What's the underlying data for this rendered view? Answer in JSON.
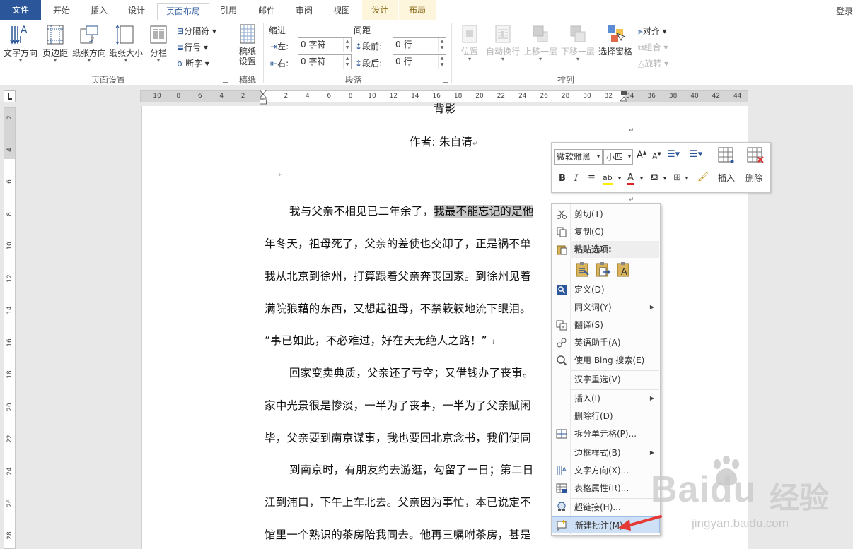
{
  "tabs": [
    "文件",
    "开始",
    "插入",
    "设计",
    "页面布局",
    "引用",
    "邮件",
    "审阅",
    "视图",
    "设计",
    "布局"
  ],
  "login": "登录",
  "ribbon": {
    "page_setup": {
      "text_direction": "文字方向",
      "margins": "页边距",
      "orientation": "纸张方向",
      "size": "纸张大小",
      "columns": "分栏",
      "breaks": "分隔符",
      "line_numbers": "行号",
      "hyphenation": "断字",
      "label": "页面设置"
    },
    "manuscript": {
      "button": "稿纸\n设置",
      "label": "稿纸"
    },
    "paragraph": {
      "indent": "缩进",
      "spacing": "间距",
      "left": "左:",
      "right": "右:",
      "before": "段前:",
      "after": "段后:",
      "left_val": "0 字符",
      "right_val": "0 字符",
      "before_val": "0 行",
      "after_val": "0 行",
      "label": "段落"
    },
    "arrange": {
      "position": "位置",
      "wrap": "自动换行",
      "forward": "上移一层",
      "backward": "下移一层",
      "pane": "选择窗格",
      "align": "对齐",
      "group": "组合",
      "rotate": "旋转",
      "label": "排列"
    }
  },
  "ruler": {
    "h_ticks": [
      "10",
      "8",
      "6",
      "4",
      "2",
      "",
      "2",
      "4",
      "6",
      "8",
      "10",
      "12",
      "14",
      "16",
      "18",
      "20",
      "22",
      "24",
      "26",
      "28",
      "30",
      "32",
      "34",
      "36",
      "38",
      "40",
      "42",
      "44"
    ],
    "v_ticks": [
      "2",
      "4",
      "6",
      "8",
      "10",
      "12",
      "14",
      "16",
      "18",
      "20",
      "22",
      "24",
      "26",
      "28"
    ]
  },
  "doc": {
    "title_fragment": "背影",
    "author": "作者: 朱自清",
    "lines": [
      "我与父亲不相见已二年余了，",
      "我最不能忘记的是他",
      "年冬天，祖母死了，父亲的差使也交卸了，正是祸不单",
      "我从北京到徐州，打算跟着父亲奔丧回家。到徐州见着",
      "满院狼藉的东西，又想起祖母，不禁簌簌地流下眼泪。",
      "“事已如此，不必难过，好在天无绝人之路！”",
      "回家变卖典质，父亲还了亏空；又借钱办了丧事。",
      "家中光景很是惨淡，一半为了丧事，一半为了父亲赋闲",
      "毕，父亲要到南京谋事，我也要回北京念书，我们便同",
      "到南京时，有朋友约去游逛，勾留了一日；第二日",
      "江到浦口，下午上车北去。父亲因为事忙，本已说定不",
      "馆里一个熟识的茶房陪我同去。他再三嘱咐茶房，甚是"
    ]
  },
  "mini_toolbar": {
    "font": "微软雅黑",
    "size": "小四",
    "insert": "插入",
    "delete": "删除"
  },
  "context_menu": {
    "cut": "剪切(T)",
    "copy": "复制(C)",
    "paste_header": "粘贴选项:",
    "define": "定义(D)",
    "synonyms": "同义词(Y)",
    "translate": "翻译(S)",
    "english": "英语助手(A)",
    "bing": "使用 Bing 搜索(E)",
    "reconvert": "汉字重选(V)",
    "insert": "插入(I)",
    "delete_row": "删除行(D)",
    "split": "拆分单元格(P)...",
    "border": "边框样式(B)",
    "text_dir": "文字方向(X)...",
    "table_props": "表格属性(R)...",
    "hyperlink": "超链接(H)...",
    "new_comment": "新建批注(M)"
  },
  "watermark": {
    "brand": "Baidu",
    "cn": "经验",
    "url": "jingyan.baidu.com"
  }
}
